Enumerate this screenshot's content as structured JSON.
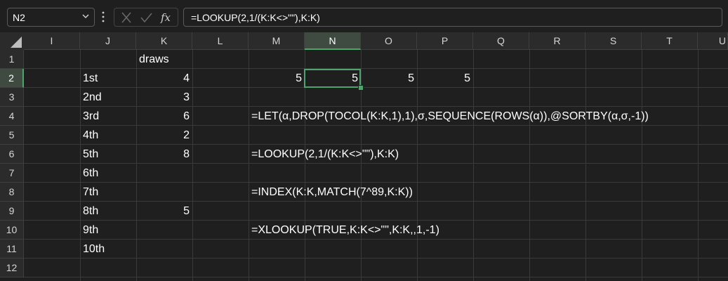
{
  "name_box": {
    "value": "N2"
  },
  "formula_bar": {
    "formula": "=LOOKUP(2,1/(K:K<>\"\"),K:K)"
  },
  "columns": [
    "I",
    "J",
    "K",
    "L",
    "M",
    "N",
    "O",
    "P",
    "Q",
    "R",
    "S",
    "T",
    "U"
  ],
  "rows": [
    "1",
    "2",
    "3",
    "4",
    "5",
    "6",
    "7",
    "8",
    "9",
    "10",
    "11",
    "12"
  ],
  "selected": {
    "column": "N",
    "row": "2"
  },
  "cells": {
    "K1": "draws",
    "J2": "1st",
    "K2": "4",
    "M2": "5",
    "N2": "5",
    "O2": "5",
    "P2": "5",
    "J3": "2nd",
    "K3": "3",
    "J4": "3rd",
    "K4": "6",
    "M4": "=LET(α,DROP(TOCOL(K:K,1),1),σ,SEQUENCE(ROWS(α)),@SORTBY(α,σ,-1))",
    "J5": "4th",
    "K5": "2",
    "J6": "5th",
    "K6": "8",
    "M6": "=LOOKUP(2,1/(K:K<>\"\"),K:K)",
    "J7": "6th",
    "J8": "7th",
    "M8": "=INDEX(K:K,MATCH(7^89,K:K))",
    "J9": "8th",
    "K9": "5",
    "J10": "9th",
    "M10": "=XLOOKUP(TRUE,K:K<>\"\",K:K,,1,-1)",
    "J11": "10th"
  },
  "colors": {
    "background": "#1f1f1f",
    "header": "#2b2b2b",
    "accent": "#4ca66c"
  }
}
